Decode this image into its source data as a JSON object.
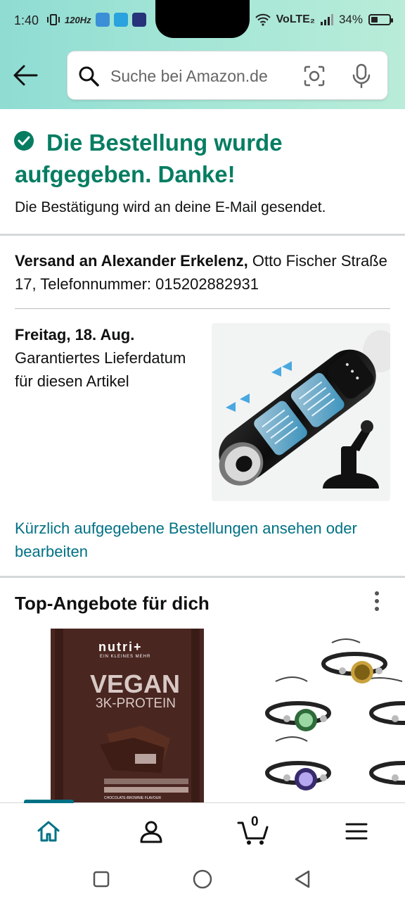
{
  "status_bar": {
    "time": "1:40",
    "network": "VoLTE₂",
    "battery": "34%",
    "refresh_rate": "120Hz"
  },
  "header": {
    "search_placeholder": "Suche bei Amazon.de"
  },
  "confirmation": {
    "title": "Die Bestellung wurde aufgegeben. Danke!",
    "subtitle": "Die Bestätigung wird an deine E-Mail gesendet."
  },
  "shipping": {
    "label": "Versand an Alexander Erkelenz,",
    "address": " Otto Fischer Straße 17, Telefonnummer: 015202882931"
  },
  "delivery": {
    "day": "Freitag, 18. Aug.",
    "note": "Garantiertes Lieferdatum für diesen Artikel"
  },
  "orders_link": "Kürzlich aufgegebene Bestellungen ansehen oder bearbeiten",
  "deals": {
    "title": "Top-Angebote für dich",
    "item1": {
      "brand": "nutri+",
      "brand_sub": "EIN KLEINES MEHR",
      "name_line1": "VEGAN",
      "name_line2": "3K-PROTEIN",
      "flavor": "CHOCOLATE-BROWNIE FLAVOUR"
    }
  },
  "bottom_nav": {
    "cart_count": "0",
    "items": [
      "home",
      "account",
      "cart",
      "menu"
    ]
  },
  "colors": {
    "accent": "#067d62",
    "link": "#007185",
    "header_gradient_start": "#8fdcd3",
    "header_gradient_end": "#b9ecd9"
  }
}
